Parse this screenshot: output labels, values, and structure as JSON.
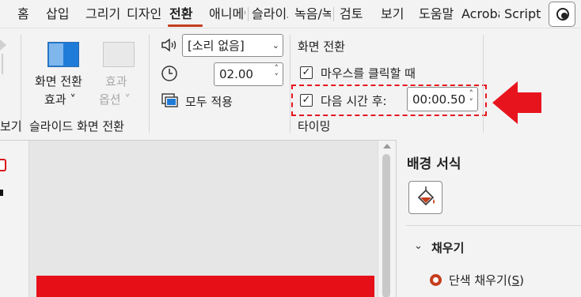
{
  "tabs": [
    {
      "label": "홈"
    },
    {
      "label": "삽입"
    },
    {
      "label": "그리기"
    },
    {
      "label": "디자인"
    },
    {
      "label": "전환",
      "active": true
    },
    {
      "label": "애니메이션"
    },
    {
      "label": "슬라이드 쇼"
    },
    {
      "label": "녹음/녹화"
    },
    {
      "label": "검토"
    },
    {
      "label": "보기"
    },
    {
      "label": "도움말"
    },
    {
      "label": "Acrobat"
    },
    {
      "label": "Script"
    }
  ],
  "ribbon": {
    "partial_left_label": "보기",
    "transition_effect_label_1": "화면 전환",
    "transition_effect_label_2": "효과 ˅",
    "effect_options_label_1": "효과",
    "effect_options_label_2": "옵션 ˅",
    "group_transitions_label": "슬라이드 화면 전환",
    "sound_value": "[소리 없음]",
    "duration_value": "02.00",
    "apply_all_label": "모두 적용",
    "advance_header": "화면 전환",
    "on_click_label": "마우스를 클릭할 때",
    "after_label": "다음 시간 후:",
    "after_value": "00:00.50",
    "group_timing_label": "타이밍"
  },
  "pane": {
    "title": "배경 서식",
    "fill_section_label": "채우기",
    "solid_fill_label": "단색 채우기(",
    "solid_fill_accel": "S",
    "solid_fill_close": ")"
  },
  "colors": {
    "accent": "#c43e1c",
    "highlight": "#e8141d",
    "slide_red": "#e60f18"
  }
}
